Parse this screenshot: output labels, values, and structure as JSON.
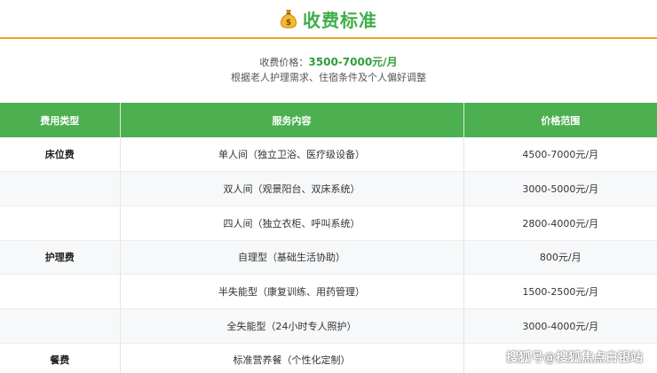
{
  "header": {
    "title": "收费标准",
    "icon": "money-bag-icon"
  },
  "summary": {
    "price_label": "收费价格：",
    "price_value": "3500-7000元/月",
    "note": "根据老人护理需求、住宿条件及个人偏好调整"
  },
  "table": {
    "headers": [
      "费用类型",
      "服务内容",
      "价格范围"
    ],
    "rows": [
      {
        "type": "床位费",
        "service": "单人间（独立卫浴、医疗级设备）",
        "price": "4500-7000元/月"
      },
      {
        "type": "",
        "service": "双人间（观景阳台、双床系统）",
        "price": "3000-5000元/月"
      },
      {
        "type": "",
        "service": "四人间（独立衣柜、呼叫系统）",
        "price": "2800-4000元/月"
      },
      {
        "type": "护理费",
        "service": "自理型（基础生活协助）",
        "price": "800元/月"
      },
      {
        "type": "",
        "service": "半失能型（康复训练、用药管理）",
        "price": "1500-2500元/月"
      },
      {
        "type": "",
        "service": "全失能型（24小时专人照护）",
        "price": "3000-4000元/月"
      },
      {
        "type": "餐费",
        "service": "标准营养餐（个性化定制）",
        "price": ""
      }
    ]
  },
  "watermark": "搜狐号@搜狐焦点白银站",
  "colors": {
    "accent": "#4caf50",
    "title": "#3fae49",
    "divider": "#f0a020"
  }
}
